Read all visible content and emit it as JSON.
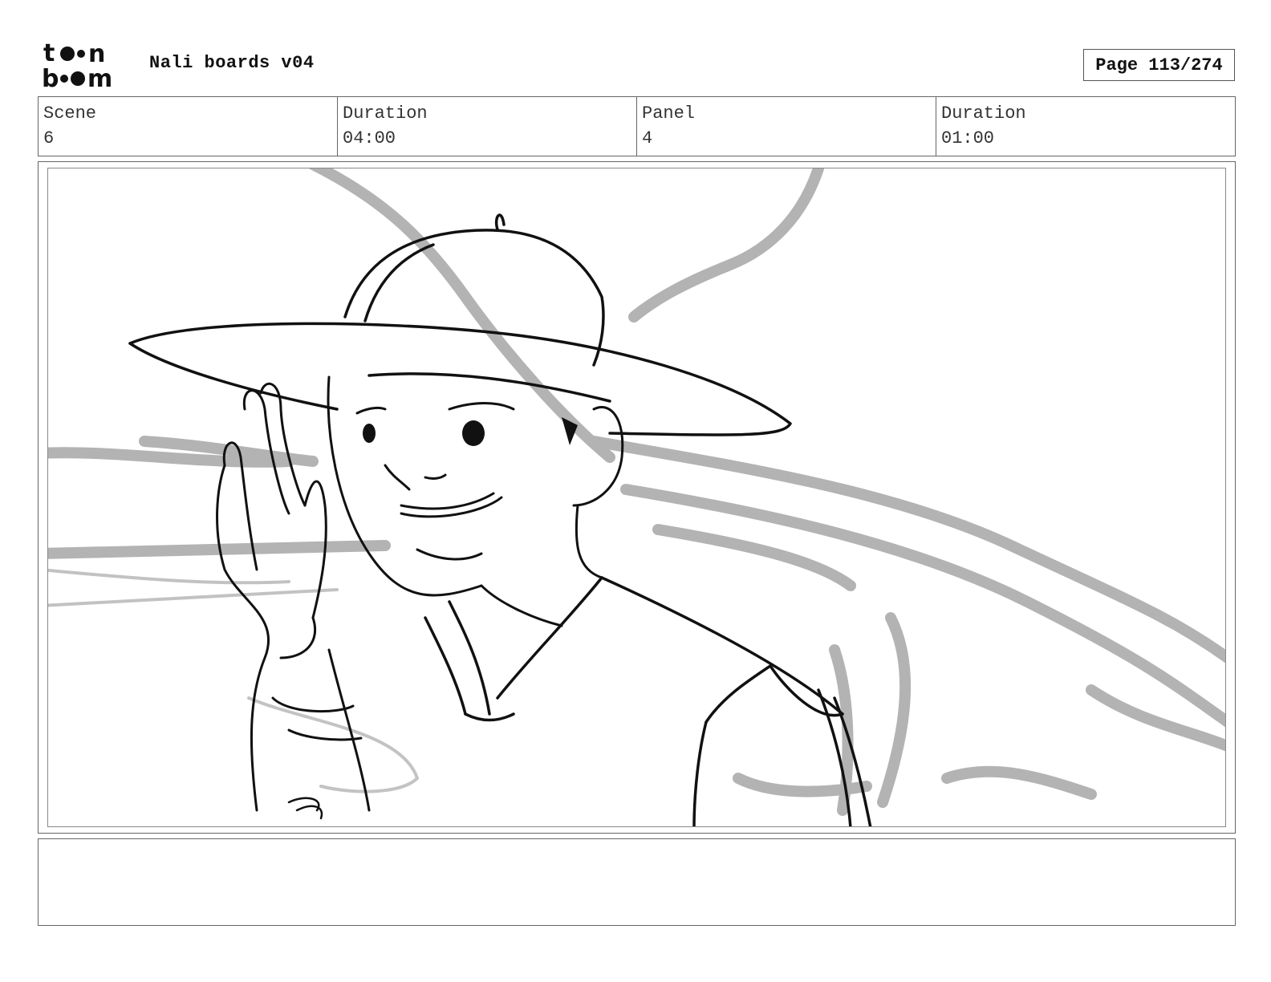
{
  "header": {
    "logo_text": "toonboom",
    "title": "Nali boards v04",
    "page_label": "Page 113/274"
  },
  "info": {
    "scene": {
      "label": "Scene",
      "value": "6"
    },
    "scene_duration": {
      "label": "Duration",
      "value": "04:00"
    },
    "panel": {
      "label": "Panel",
      "value": "4"
    },
    "panel_duration": {
      "label": "Duration",
      "value": "01:00"
    }
  },
  "panel_image": {
    "description_icon": "sketch-character-waving-icon"
  },
  "notes": {
    "text": ""
  }
}
